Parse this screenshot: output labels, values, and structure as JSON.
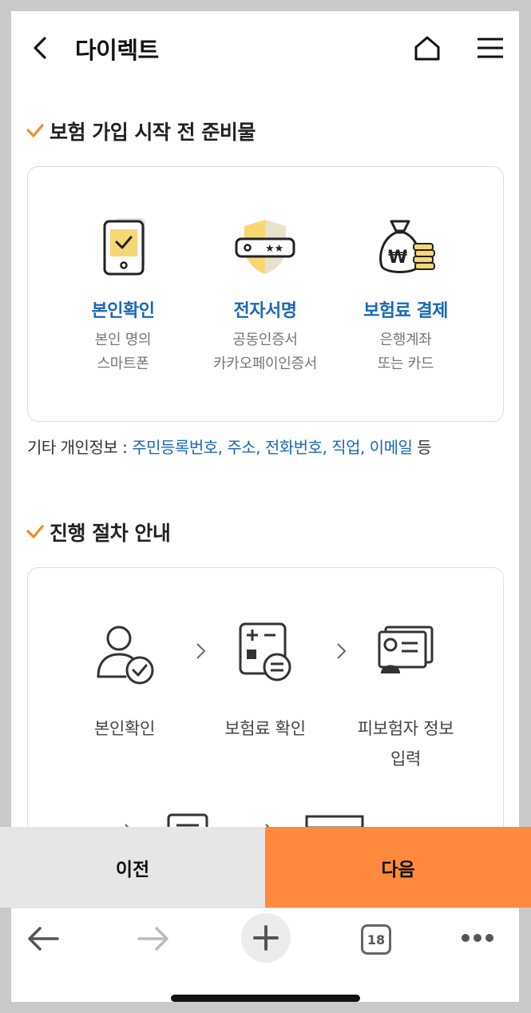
{
  "header": {
    "title": "다이렉트"
  },
  "prep_section": {
    "title": "보험 가입 시작 전 준비물",
    "items": [
      {
        "name": "본인확인",
        "desc1": "본인 명의",
        "desc2": "스마트폰",
        "icon": "phone-check-icon"
      },
      {
        "name": "전자서명",
        "desc1": "공동인증서",
        "desc2": "카카오페이인증서",
        "icon": "shield-password-icon"
      },
      {
        "name": "보험료 결제",
        "desc1": "은행계좌",
        "desc2": "또는 카드",
        "icon": "money-bag-icon"
      }
    ],
    "other_prefix": "기타 개인정보 : ",
    "other_links": "주민등록번호, 주소, 전화번호, 직업, 이메일",
    "other_suffix": " 등"
  },
  "process_section": {
    "title": "진행 절차 안내",
    "steps": [
      {
        "label": "본인확인",
        "icon": "person-check-icon"
      },
      {
        "label": "보험료 확인",
        "icon": "calculator-icon"
      },
      {
        "label": "피보험자 정보",
        "label2": "입력",
        "icon": "id-card-icon"
      }
    ]
  },
  "footer": {
    "prev_label": "이전",
    "next_label": "다음",
    "accent": "#ff8a3d"
  },
  "browser_toolbar": {
    "tab_count": "18"
  },
  "colors": {
    "link_blue": "#1a67b8",
    "check_orange": "#f28b2c",
    "icon_yellow": "#f7d774"
  }
}
